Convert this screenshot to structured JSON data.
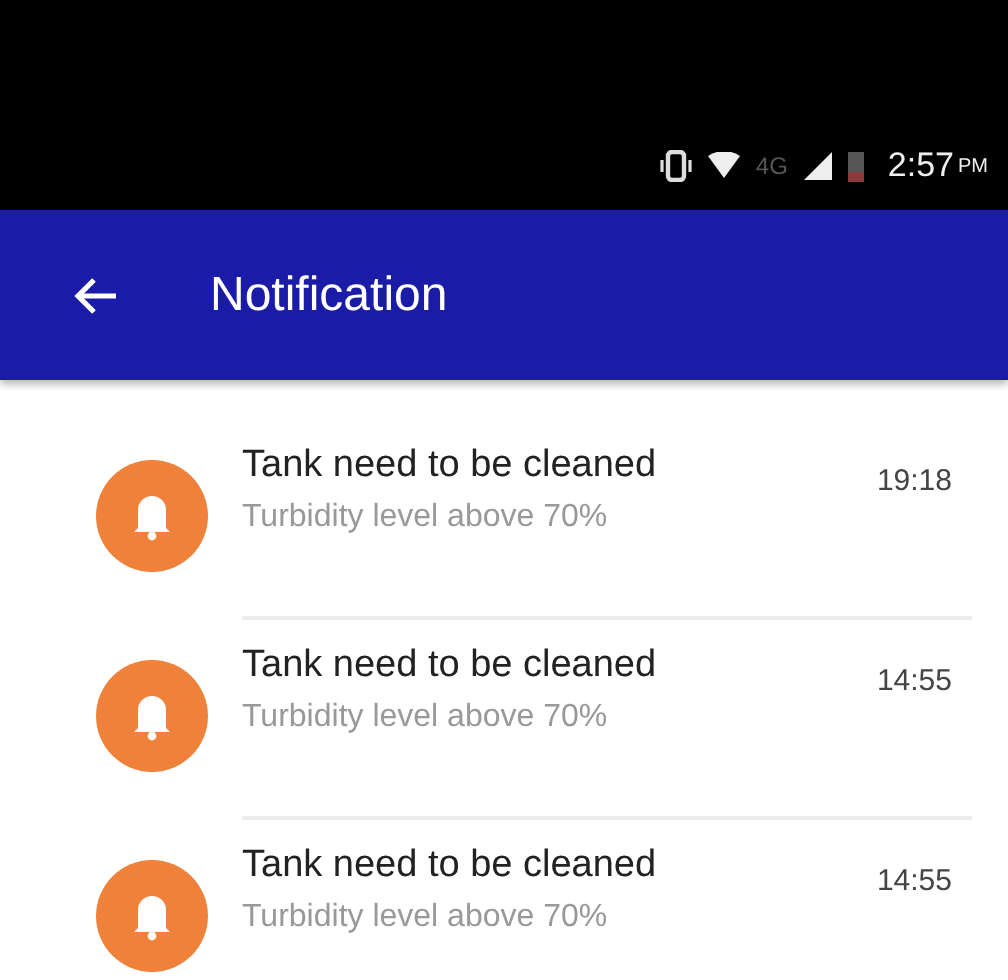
{
  "status_bar": {
    "network": "4G",
    "time": "2:57",
    "ampm": "PM"
  },
  "app_bar": {
    "title": "Notification"
  },
  "notifications": [
    {
      "title": "Tank need to be cleaned",
      "subtitle": "Turbidity level above 70%",
      "time": "19:18"
    },
    {
      "title": "Tank need to be cleaned",
      "subtitle": "Turbidity level above 70%",
      "time": "14:55"
    },
    {
      "title": "Tank need to be cleaned",
      "subtitle": "Turbidity level above 70%",
      "time": "14:55"
    }
  ]
}
